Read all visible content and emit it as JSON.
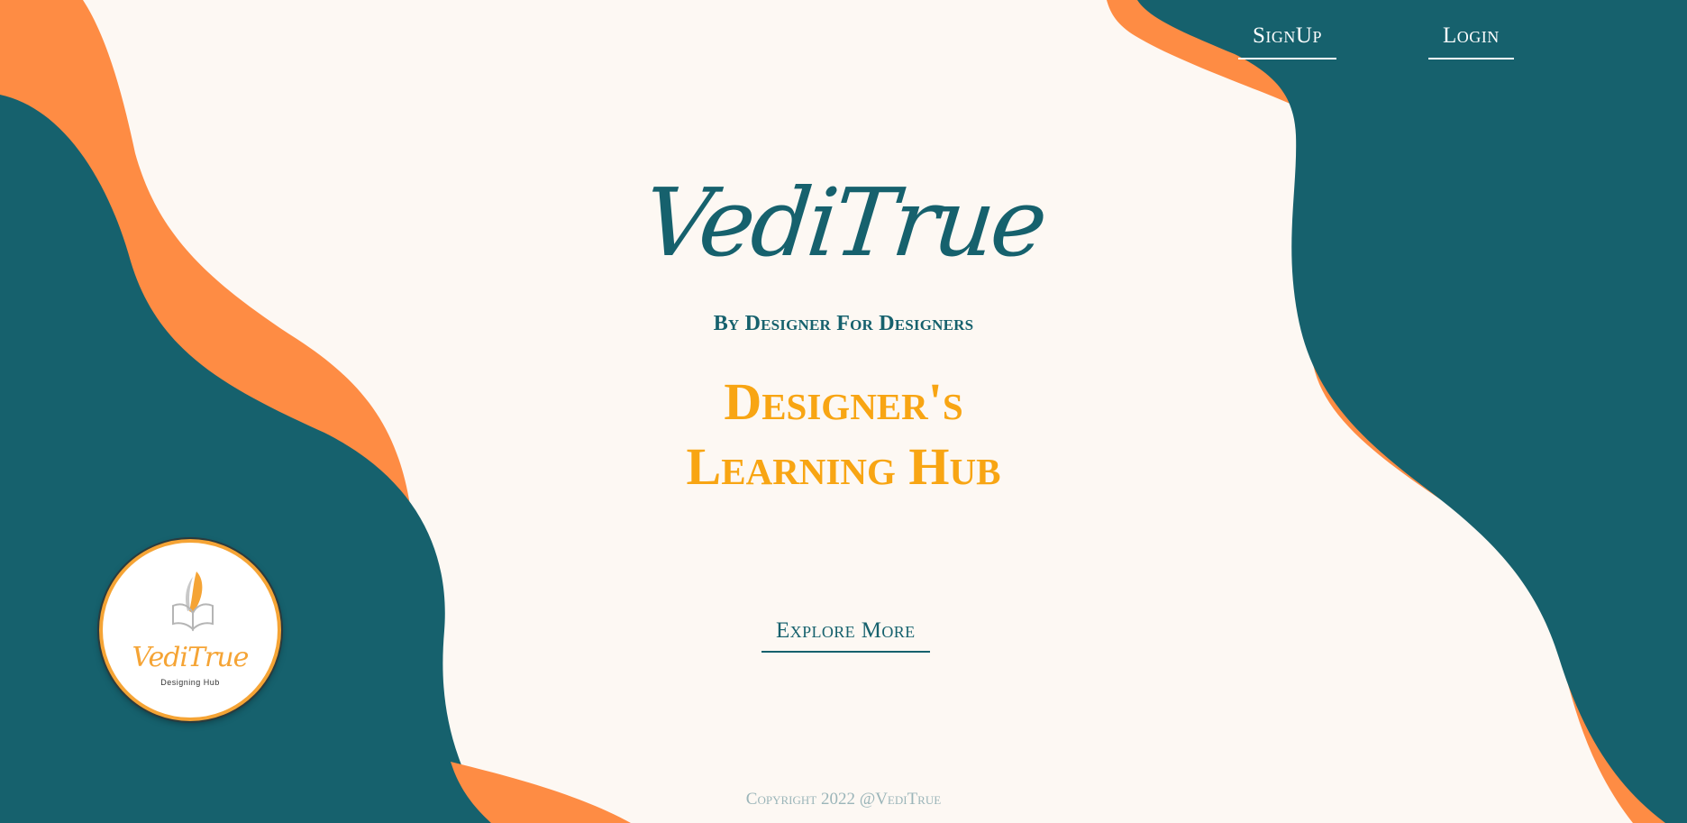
{
  "colors": {
    "background": "#fdf8f3",
    "teal": "#16616d",
    "orange": "#fe8c44",
    "headline_gold": "#f8a513",
    "footer_gray": "#9bb5b9"
  },
  "nav": {
    "signup_label": "SignUp",
    "login_label": "Login"
  },
  "hero": {
    "brand": "VediTrue",
    "tagline": "By Designer For Designers",
    "headline_line1": "Designer's",
    "headline_line2": "Learning Hub",
    "cta_label": "Explore More"
  },
  "logo": {
    "name": "VediTrue",
    "subtitle": "Designing Hub",
    "icon": "quill-book-icon"
  },
  "footer": {
    "copyright": "Copyright 2022 @VediTrue"
  }
}
